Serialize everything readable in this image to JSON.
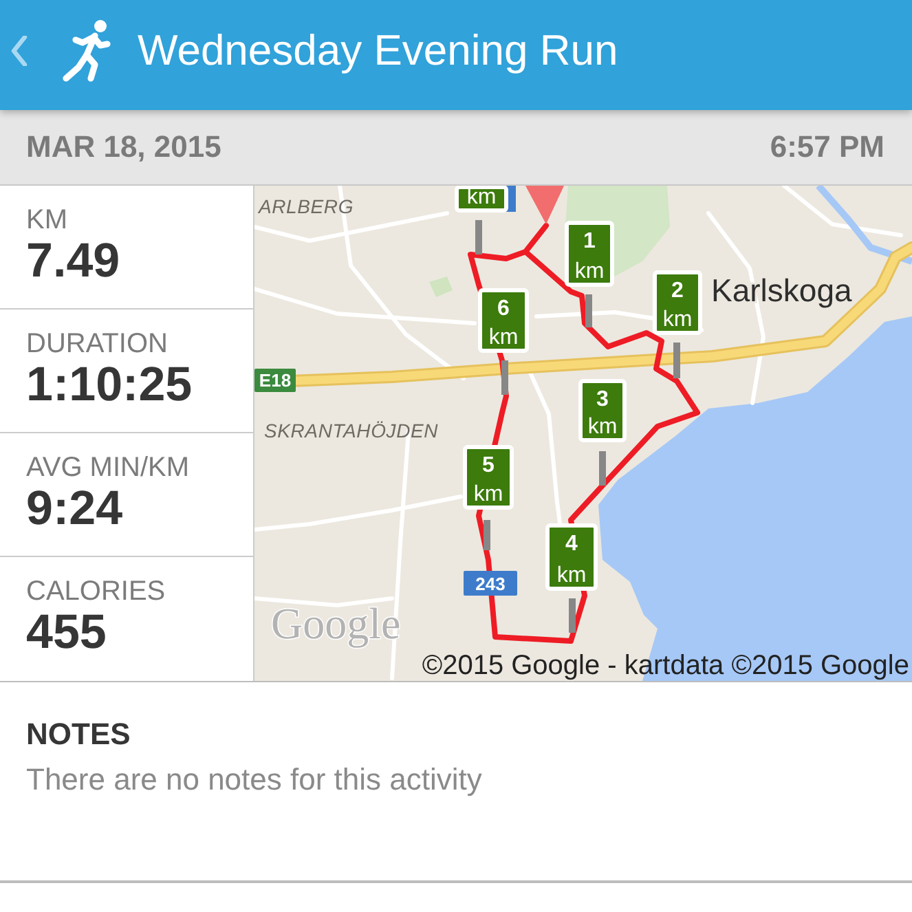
{
  "app_bar": {
    "title": "Wednesday Evening Run"
  },
  "date_bar": {
    "date": "MAR 18, 2015",
    "time": "6:57 PM"
  },
  "stats": [
    {
      "label": "KM",
      "value": "7.49"
    },
    {
      "label": "DURATION",
      "value": "1:10:25"
    },
    {
      "label": "AVG MIN/KM",
      "value": "9:24"
    },
    {
      "label": "CALORIES",
      "value": "455"
    }
  ],
  "map": {
    "place_labels": [
      {
        "text": "ARLBERG",
        "kind": "district"
      },
      {
        "text": "Karlskoga",
        "kind": "town"
      },
      {
        "text": "SKRANTAHÖJDEN",
        "kind": "district"
      }
    ],
    "road_shields": [
      {
        "text": "E18",
        "kind": "european"
      },
      {
        "text": "243",
        "kind": "national"
      }
    ],
    "km_markers": [
      {
        "unit": "km"
      },
      {
        "number": "1",
        "unit": "km"
      },
      {
        "number": "2",
        "unit": "km"
      },
      {
        "number": "6",
        "unit": "km"
      },
      {
        "number": "3",
        "unit": "km"
      },
      {
        "number": "5",
        "unit": "km"
      },
      {
        "number": "4",
        "unit": "km"
      }
    ],
    "logo": "Google",
    "attribution": "©2015 Google - kartdata ©2015 Google"
  },
  "notes": {
    "heading": "NOTES",
    "text": "There are no notes for this activity"
  }
}
